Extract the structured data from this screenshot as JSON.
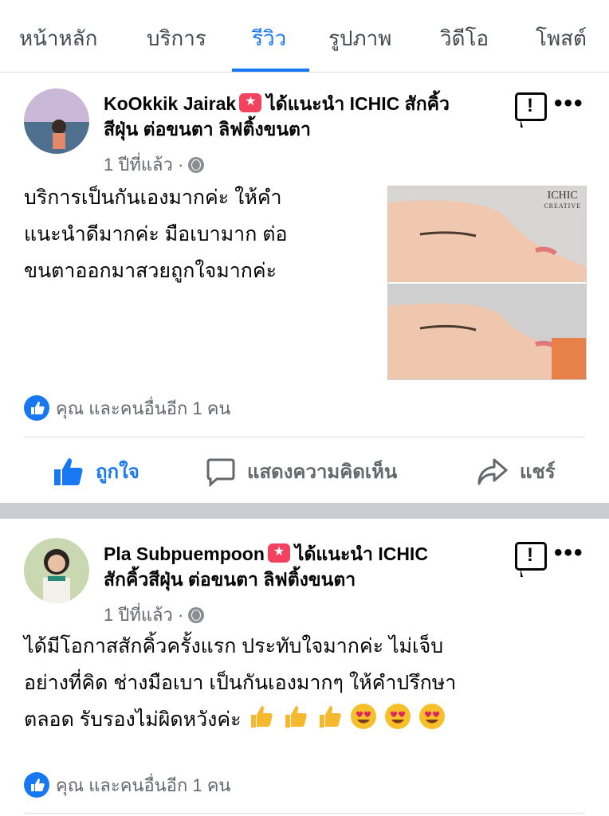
{
  "tabs": [
    {
      "label": "หน้าหลัก",
      "active": false
    },
    {
      "label": "บริการ",
      "active": false
    },
    {
      "label": "รีวิว",
      "active": true
    },
    {
      "label": "รูปภาพ",
      "active": false
    },
    {
      "label": "วิดีโอ",
      "active": false
    },
    {
      "label": "โพสต์",
      "active": false
    }
  ],
  "colors": {
    "accent": "#1877f2",
    "recommend": "#f3425f",
    "muted": "#65676b"
  },
  "posts": [
    {
      "author": "KoOkkik Jairak",
      "recommend_text": "ได้แนะนำ ICHIC สักคิ้ว",
      "recommend_text2": "สีฝุ่น ต่อขนตา ลิฟติ้งขนตา",
      "time": "1 ปีที่แล้ว",
      "separator": "·",
      "body_lines": [
        "บริการเป็นกันเองมากค่ะ  ให้คำ",
        "แนะนำดีมากค่ะ มือเบามาก ต่อ",
        "ขนตาออกมาสวยถูกใจมากค่ะ"
      ],
      "photo_logo": "ICHIC",
      "photo_logo_sub": "CREATIVE",
      "reactions": "คุณ และคนอื่นอีก 1 คน",
      "actions": {
        "like": "ถูกใจ",
        "comment": "แสดงความคิดเห็น",
        "share": "แชร์"
      }
    },
    {
      "author": "Pla Subpuempoon",
      "recommend_text": "ได้แนะนำ ICHIC",
      "recommend_text2": "สักคิ้วสีฝุ่น ต่อขนตา ลิฟติ้งขนตา",
      "time": "1 ปีที่แล้ว",
      "separator": "·",
      "body_lines": [
        "ได้มีโอกาสสักคิ้วครั้งแรก ประทับใจมากค่ะ  ไม่เจ็บ",
        "อย่างที่คิด  ช่างมือเบา เป็นกันเองมากๆ  ให้คำปรึกษา",
        "ตลอด  รับรองไม่ผิดหวังค่ะ"
      ],
      "reactions": "คุณ และคนอื่นอีก 1 คน"
    }
  ]
}
